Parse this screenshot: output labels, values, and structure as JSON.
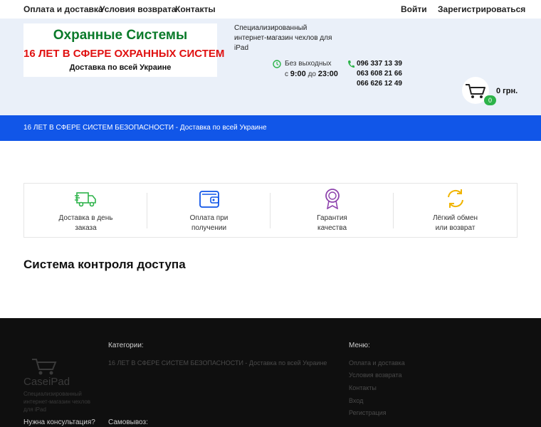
{
  "nav": {
    "left": [
      "Оплата и доставка",
      "Условия возврата",
      "Контакты"
    ],
    "login": "Войти",
    "register": "Зарегистрироваться"
  },
  "logo": {
    "line1": "Охранные Системы",
    "line2": "16 ЛЕТ В СФЕРЕ ОХРАННЫХ СИСТЕМ",
    "line3": "Доставка по всей Украине"
  },
  "tagline": "Специализированный интернет-магазин чехлов для iPad",
  "hours": {
    "line1": "Без выходных",
    "from_word": "с",
    "from": "9:00",
    "to_word": "до",
    "to": "23:00"
  },
  "phones": [
    "096 337 13 39",
    "063 608 21 66",
    "066 626 12 49"
  ],
  "cart": {
    "count": "0",
    "total": "0 грн."
  },
  "banner": "16 ЛЕТ В СФЕРЕ СИСТЕМ БЕЗОПАСНОСТИ - Доставка по всей Украине",
  "features": [
    {
      "icon": "truck-icon",
      "line1": "Доставка в день",
      "line2": "заказа"
    },
    {
      "icon": "wallet-icon",
      "line1": "Оплата при",
      "line2": "получении"
    },
    {
      "icon": "award-icon",
      "line1": "Гарантия",
      "line2": "качества"
    },
    {
      "icon": "refresh-icon",
      "line1": "Лёгкий обмен",
      "line2": "или возврат"
    }
  ],
  "page_title": "Система контроля доступа",
  "footer": {
    "logo_text": "CaseiPad",
    "description": "Специализированный интернет-магазин чехлов для iPad",
    "categories_heading": "Категории:",
    "category_link": "16 ЛЕТ В СФЕРЕ СИСТЕМ БЕЗОПАСНОСТИ - Доставка по всей Украине",
    "menu_heading": "Меню:",
    "menu": [
      "Оплата и доставка",
      "Условия возврата",
      "Контакты",
      "Вход",
      "Регистрация"
    ],
    "consult": "Нужна консультация?",
    "pickup": "Самовывоз:"
  },
  "colors": {
    "accent_blue": "#1156e8",
    "green": "#2db34a",
    "purple": "#8e44ad",
    "yellow": "#f0b400",
    "logo_green": "#0a7a2a",
    "logo_red": "#e01010"
  }
}
